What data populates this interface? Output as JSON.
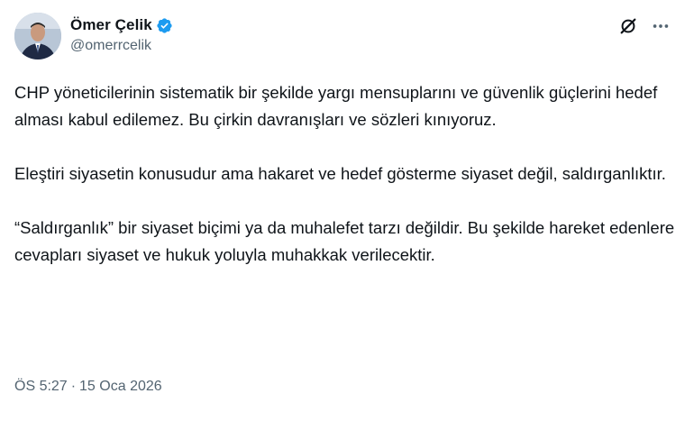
{
  "author": {
    "display_name": "Ömer Çelik",
    "handle": "@omerrcelik",
    "verified": true,
    "verified_color": "#1d9bf0",
    "avatar_icon": "profile-photo"
  },
  "actions": {
    "grok_icon": "grok-icon",
    "more_icon": "more-icon"
  },
  "tweet": {
    "paragraphs": [
      "CHP yöneticilerinin sistematik bir şekilde yargı mensuplarını ve güvenlik güçlerini hedef alması kabul edilemez. Bu çirkin davranışları ve sözleri kınıyoruz.",
      "Eleştiri siyasetin konusudur ama hakaret ve hedef gösterme siyaset değil, saldırganlıktır.",
      "“Saldırganlık” bir siyaset biçimi ya da muhalefet tarzı değildir. Bu şekilde hareket edenlere cevapları siyaset ve hukuk yoluyla muhakkak verilecektir."
    ],
    "time": "ÖS 5:27",
    "separator": "·",
    "date": "15 Oca 2026"
  },
  "colors": {
    "text": "#0f1419",
    "secondary": "#536471"
  }
}
